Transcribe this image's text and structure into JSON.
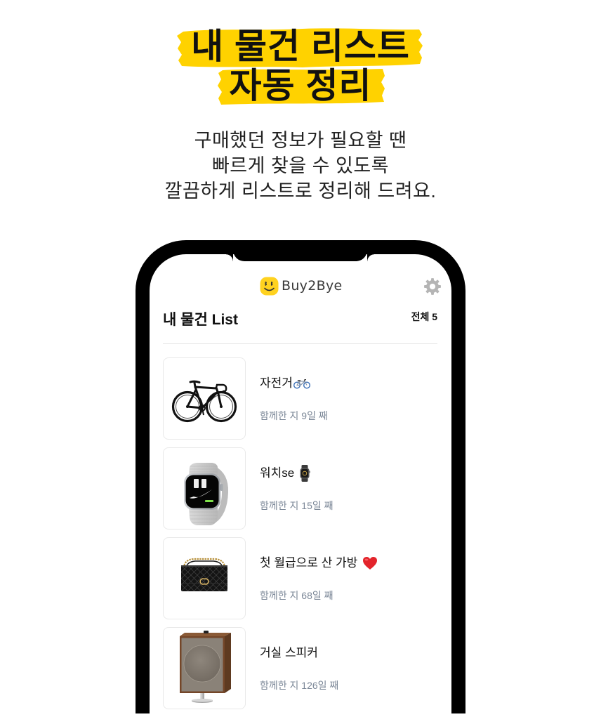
{
  "headline": {
    "line1": "내 물건 리스트",
    "line2": "자동 정리"
  },
  "subtitle": {
    "line1": "구매했던 정보가 필요할 땐",
    "line2": "빠르게 찾을 수 있도록",
    "line3": "깔끔하게 리스트로 정리해 드려요."
  },
  "app": {
    "brand_name": "Buy2Bye",
    "logo_icon": "smiley-logo-icon",
    "settings_icon": "gear-icon",
    "list_title": "내 물건 List",
    "total_count": "전체 5"
  },
  "items": [
    {
      "title": "자전거",
      "emoji_icon": "bicycle-emoji-icon",
      "since": "함께한 지 9일 째",
      "thumbnail_icon": "bicycle-photo"
    },
    {
      "title": "워치se",
      "emoji_icon": "watch-emoji-icon",
      "since": "함께한 지 15일 째",
      "thumbnail_icon": "smartwatch-photo"
    },
    {
      "title": "첫 월급으로 산 가방",
      "emoji_icon": "red-heart-emoji-icon",
      "since": "함께한 지 68일 째",
      "thumbnail_icon": "quilted-handbag-photo"
    },
    {
      "title": "거실 스피커",
      "since": "함께한 지 126일 째",
      "thumbnail_icon": "wooden-speaker-photo"
    }
  ],
  "colors": {
    "highlight": "#ffd200",
    "logo": "#ffd21f",
    "text_primary": "#111111",
    "text_meta": "#7b8797",
    "phone_frame": "#000000",
    "settings_icon": "#b5b5b5"
  }
}
